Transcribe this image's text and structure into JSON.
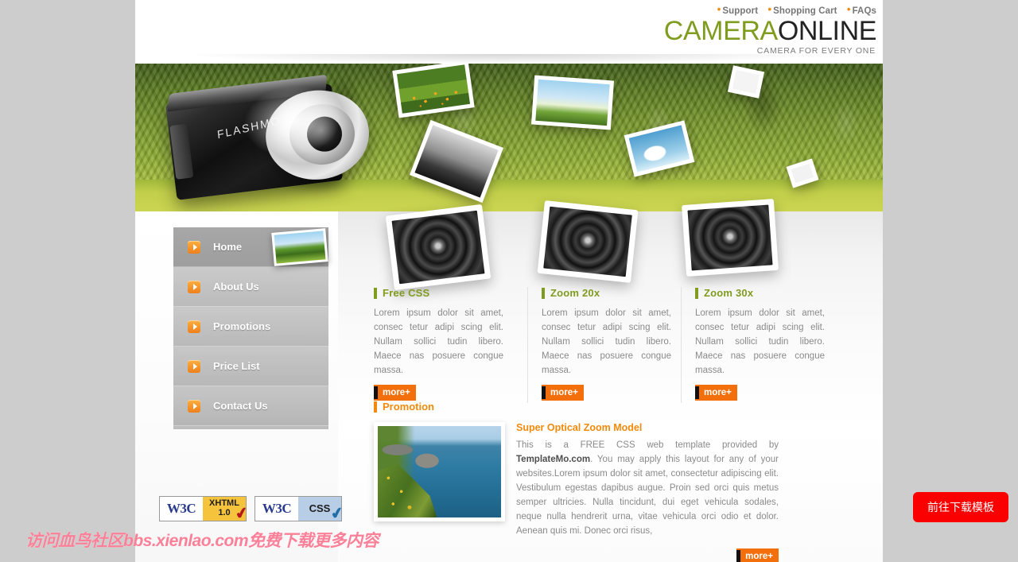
{
  "topnav": {
    "items": [
      {
        "label": "Support"
      },
      {
        "label": "Shopping Cart"
      },
      {
        "label": "FAQs"
      }
    ],
    "bullet": "•"
  },
  "logo": {
    "name_green": "CAMERA",
    "name_dark": "ONLINE",
    "tagline": "CAMERA FOR EVERY ONE"
  },
  "banner": {
    "camera_brand": "FLASHMO"
  },
  "sidebar": {
    "items": [
      {
        "label": "Home",
        "active": true
      },
      {
        "label": "About Us",
        "active": false
      },
      {
        "label": "Promotions",
        "active": false
      },
      {
        "label": "Price List",
        "active": false
      },
      {
        "label": "Contact Us",
        "active": false
      }
    ]
  },
  "columns": [
    {
      "title": "Free CSS",
      "body": "Lorem ipsum dolor sit amet, consec tetur adipi scing elit. Nullam sollici tudin libero. Maece nas posuere congue massa.",
      "more": "more+"
    },
    {
      "title": "Zoom 20x",
      "body": "Lorem ipsum dolor sit amet, consec tetur adipi scing elit. Nullam sollici tudin libero. Maece nas posuere congue massa.",
      "more": "more+"
    },
    {
      "title": "Zoom 30x",
      "body": "Lorem ipsum dolor sit amet, consec tetur adipi scing elit. Nullam sollici tudin libero. Maece nas posuere congue massa.",
      "more": "more+"
    }
  ],
  "promotion": {
    "section_title": "Promotion",
    "item_title": "Super Optical Zoom Model",
    "body_pre": "This is a FREE CSS web template provided by ",
    "body_link": "TemplateMo.com",
    "body_post": ". You may apply this layout for any of your websites.Lorem ipsum dolor sit amet, consectetur adipiscing elit. Vestibulum egestas dapibus augue. Proin sed orci quis metus semper ultricies. Nulla tincidunt, dui eget vehicula sodales, neque nulla hendrerit urna, vitae vehicula orci odio et dolor. Aenean quis mi. Donec orci risus,",
    "more": "more+"
  },
  "badges": [
    {
      "org": "W3C",
      "kind_line1": "XHTML",
      "kind_line2": "1.0",
      "check": "✔"
    },
    {
      "org": "W3C",
      "kind_line1": "CSS",
      "kind_line2": "",
      "check": "✔"
    }
  ],
  "watermark": {
    "text": "访问血鸟社区bbs.xienlao.com免费下载更多内容"
  },
  "download_button": {
    "label": "前往下载模板"
  },
  "colors": {
    "accent_green": "#7f9c1f",
    "accent_orange": "#f18a0a",
    "more_orange": "#f26f0c",
    "banner_green": "#c9d44d",
    "sidebar_gray": "#c6c6c6",
    "download_red": "#fb0000",
    "watermark_pink": "#fb8098"
  }
}
